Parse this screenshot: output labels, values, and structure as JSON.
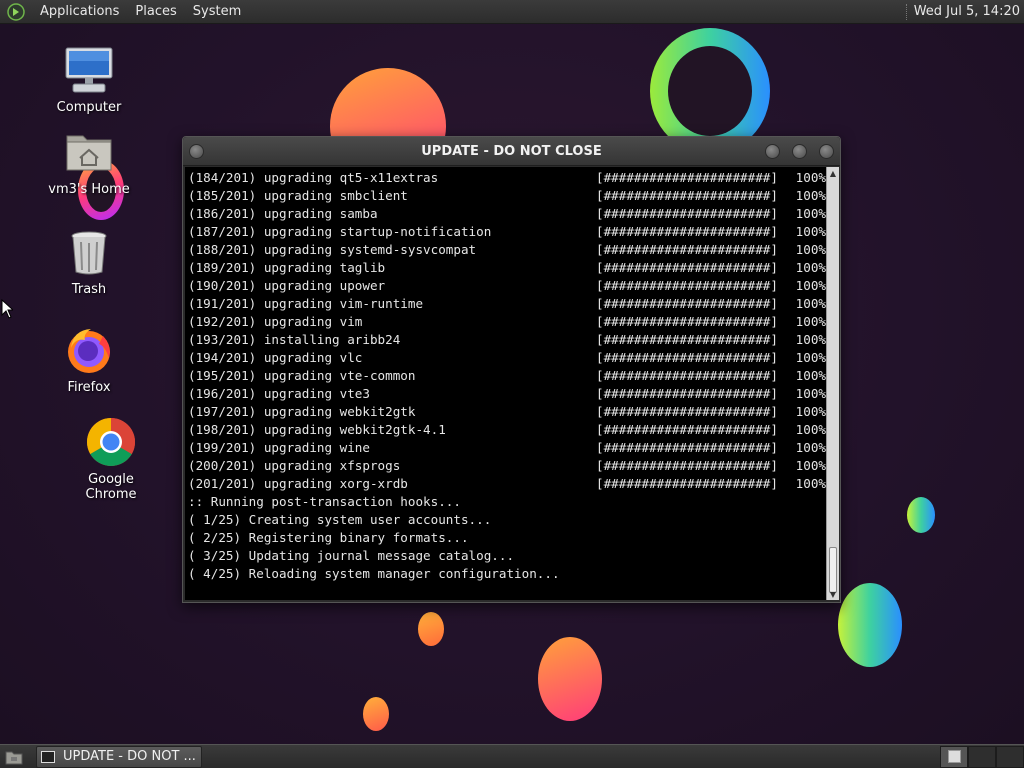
{
  "top_panel": {
    "menus": [
      "Applications",
      "Places",
      "System"
    ],
    "clock": "Wed Jul  5, 14:20"
  },
  "desktop_icons": [
    {
      "label": "Computer",
      "icon": "computer-icon"
    },
    {
      "label": "vm3's Home",
      "icon": "home-folder-icon"
    },
    {
      "label": "Trash",
      "icon": "trash-icon"
    },
    {
      "label": "Firefox",
      "icon": "firefox-icon"
    },
    {
      "label": "Google Chrome",
      "icon": "chrome-icon"
    }
  ],
  "window": {
    "title": "UPDATE - DO NOT CLOSE",
    "progress_lines": [
      {
        "text": "(184/201) upgrading qt5-x11extras",
        "bar": "[######################]",
        "pct": "100%"
      },
      {
        "text": "(185/201) upgrading smbclient",
        "bar": "[######################]",
        "pct": "100%"
      },
      {
        "text": "(186/201) upgrading samba",
        "bar": "[######################]",
        "pct": "100%"
      },
      {
        "text": "(187/201) upgrading startup-notification",
        "bar": "[######################]",
        "pct": "100%"
      },
      {
        "text": "(188/201) upgrading systemd-sysvcompat",
        "bar": "[######################]",
        "pct": "100%"
      },
      {
        "text": "(189/201) upgrading taglib",
        "bar": "[######################]",
        "pct": "100%"
      },
      {
        "text": "(190/201) upgrading upower",
        "bar": "[######################]",
        "pct": "100%"
      },
      {
        "text": "(191/201) upgrading vim-runtime",
        "bar": "[######################]",
        "pct": "100%"
      },
      {
        "text": "(192/201) upgrading vim",
        "bar": "[######################]",
        "pct": "100%"
      },
      {
        "text": "(193/201) installing aribb24",
        "bar": "[######################]",
        "pct": "100%"
      },
      {
        "text": "(194/201) upgrading vlc",
        "bar": "[######################]",
        "pct": "100%"
      },
      {
        "text": "(195/201) upgrading vte-common",
        "bar": "[######################]",
        "pct": "100%"
      },
      {
        "text": "(196/201) upgrading vte3",
        "bar": "[######################]",
        "pct": "100%"
      },
      {
        "text": "(197/201) upgrading webkit2gtk",
        "bar": "[######################]",
        "pct": "100%"
      },
      {
        "text": "(198/201) upgrading webkit2gtk-4.1",
        "bar": "[######################]",
        "pct": "100%"
      },
      {
        "text": "(199/201) upgrading wine",
        "bar": "[######################]",
        "pct": "100%"
      },
      {
        "text": "(200/201) upgrading xfsprogs",
        "bar": "[######################]",
        "pct": "100%"
      },
      {
        "text": "(201/201) upgrading xorg-xrdb",
        "bar": "[######################]",
        "pct": "100%"
      }
    ],
    "hook_lines": [
      ":: Running post-transaction hooks...",
      "( 1/25) Creating system user accounts...",
      "( 2/25) Registering binary formats...",
      "( 3/25) Updating journal message catalog...",
      "( 4/25) Reloading system manager configuration..."
    ]
  },
  "bottom_panel": {
    "task_label": "UPDATE - DO NOT ..."
  }
}
